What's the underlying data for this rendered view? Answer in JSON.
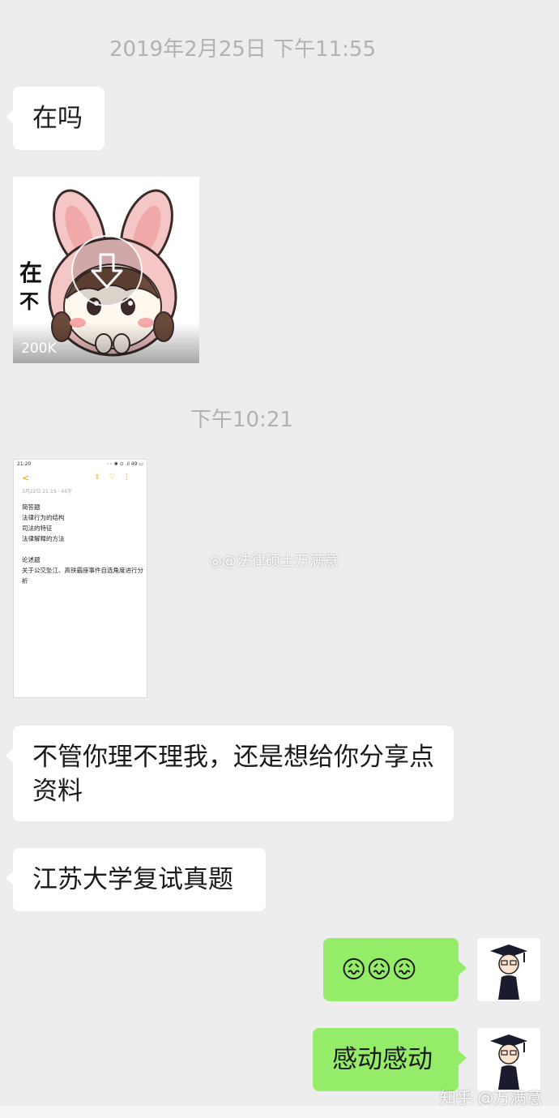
{
  "messages": {
    "timestamp_1": "2019年2月25日 下午11:55",
    "msg_1": "在吗",
    "sticker": {
      "size_label": "200K",
      "text_top": "在",
      "text_bottom": "不"
    },
    "timestamp_2": "下午10:21",
    "screenshot": {
      "status_time": "21:20",
      "status_right": "◦◦ ✱ ⊙ .ıl 49 ▭",
      "meta": "3月22日 21:19 · 46字",
      "lines": [
        "简答题",
        "法律行为的结构",
        "司法的特征",
        "法律解释的方法",
        "",
        "论述题",
        "关于公交坠江、高铁霸座事件自选角度进行分析"
      ]
    },
    "msg_2": "不管你理不理我，还是想给你分享点资料",
    "msg_3": "江苏大学复试真题",
    "msg_4": "😖😖😖",
    "msg_5": "感动感动"
  },
  "watermarks": {
    "weibo": "@法律硕士万满意",
    "zhihu": "知乎 @万满意"
  },
  "colors": {
    "background": "#ededed",
    "incoming": "#ffffff",
    "outgoing": "#95ec69",
    "timestamp": "#b2b2b2"
  }
}
